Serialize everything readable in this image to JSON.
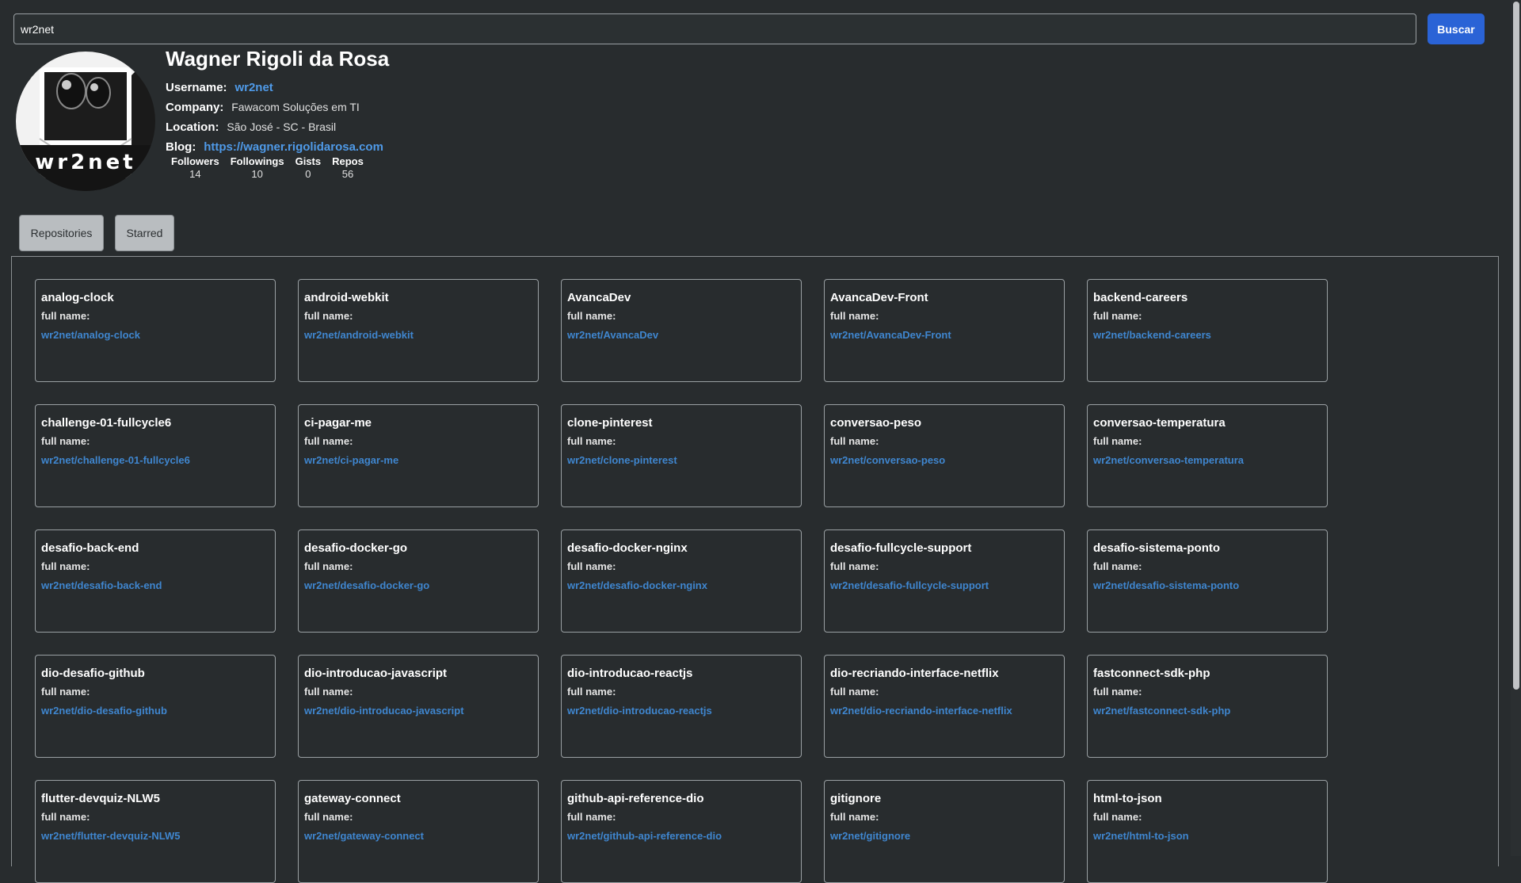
{
  "search": {
    "value": "wr2net",
    "button_label": "Buscar"
  },
  "profile": {
    "avatar_text": "wr2net",
    "name": "Wagner Rigoli da Rosa",
    "username_label": "Username:",
    "username": "wr2net",
    "company_label": "Company:",
    "company": "Fawacom Soluções em TI",
    "location_label": "Location:",
    "location": "São José - SC - Brasil",
    "blog_label": "Blog:",
    "blog": "https://wagner.rigolidarosa.com",
    "stats": [
      {
        "label": "Followers",
        "value": "14"
      },
      {
        "label": "Followings",
        "value": "10"
      },
      {
        "label": "Gists",
        "value": "0"
      },
      {
        "label": "Repos",
        "value": "56"
      }
    ]
  },
  "tabs": {
    "repositories": "Repositories",
    "starred": "Starred"
  },
  "repo_fullname_label": "full name:",
  "repos": [
    {
      "name": "analog-clock",
      "full_name": "wr2net/analog-clock"
    },
    {
      "name": "android-webkit",
      "full_name": "wr2net/android-webkit"
    },
    {
      "name": "AvancaDev",
      "full_name": "wr2net/AvancaDev"
    },
    {
      "name": "AvancaDev-Front",
      "full_name": "wr2net/AvancaDev-Front"
    },
    {
      "name": "backend-careers",
      "full_name": "wr2net/backend-careers"
    },
    {
      "name": "challenge-01-fullcycle6",
      "full_name": "wr2net/challenge-01-fullcycle6"
    },
    {
      "name": "ci-pagar-me",
      "full_name": "wr2net/ci-pagar-me"
    },
    {
      "name": "clone-pinterest",
      "full_name": "wr2net/clone-pinterest"
    },
    {
      "name": "conversao-peso",
      "full_name": "wr2net/conversao-peso"
    },
    {
      "name": "conversao-temperatura",
      "full_name": "wr2net/conversao-temperatura"
    },
    {
      "name": "desafio-back-end",
      "full_name": "wr2net/desafio-back-end"
    },
    {
      "name": "desafio-docker-go",
      "full_name": "wr2net/desafio-docker-go"
    },
    {
      "name": "desafio-docker-nginx",
      "full_name": "wr2net/desafio-docker-nginx"
    },
    {
      "name": "desafio-fullcycle-support",
      "full_name": "wr2net/desafio-fullcycle-support"
    },
    {
      "name": "desafio-sistema-ponto",
      "full_name": "wr2net/desafio-sistema-ponto"
    },
    {
      "name": "dio-desafio-github",
      "full_name": "wr2net/dio-desafio-github"
    },
    {
      "name": "dio-introducao-javascript",
      "full_name": "wr2net/dio-introducao-javascript"
    },
    {
      "name": "dio-introducao-reactjs",
      "full_name": "wr2net/dio-introducao-reactjs"
    },
    {
      "name": "dio-recriando-interface-netflix",
      "full_name": "wr2net/dio-recriando-interface-netflix"
    },
    {
      "name": "fastconnect-sdk-php",
      "full_name": "wr2net/fastconnect-sdk-php"
    },
    {
      "name": "flutter-devquiz-NLW5",
      "full_name": "wr2net/flutter-devquiz-NLW5"
    },
    {
      "name": "gateway-connect",
      "full_name": "wr2net/gateway-connect"
    },
    {
      "name": "github-api-reference-dio",
      "full_name": "wr2net/github-api-reference-dio"
    },
    {
      "name": "gitignore",
      "full_name": "wr2net/gitignore"
    },
    {
      "name": "html-to-json",
      "full_name": "wr2net/html-to-json"
    }
  ]
}
